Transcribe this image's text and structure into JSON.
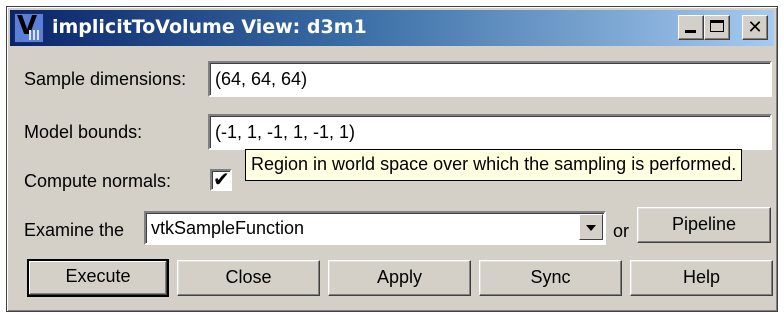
{
  "window": {
    "title": "implicitToVolume View: d3m1",
    "icon": "vtk-logo-icon",
    "controls": {
      "minimize": "minimize-icon",
      "maximize": "maximize-icon",
      "close_glyph": "✕"
    }
  },
  "form": {
    "sample_dimensions": {
      "label": "Sample dimensions:",
      "value": "(64, 64, 64)"
    },
    "model_bounds": {
      "label": "Model bounds:",
      "value": "(-1, 1, -1, 1, -1, 1)"
    },
    "compute_normals": {
      "label": "Compute normals:",
      "checked": true
    }
  },
  "tooltip": {
    "text": "Region in world space over which the sampling is performed."
  },
  "examine": {
    "label": "Examine the",
    "selected": "vtkSampleFunction",
    "or_label": "or",
    "pipeline_label": "Pipeline"
  },
  "buttons": {
    "execute": "Execute",
    "close": "Close",
    "apply": "Apply",
    "sync": "Sync",
    "help": "Help"
  },
  "colors": {
    "titlebar_start": "#0a246a",
    "titlebar_end": "#a6caf0",
    "face": "#d4d0c8",
    "tooltip_bg": "#ffffe1"
  }
}
